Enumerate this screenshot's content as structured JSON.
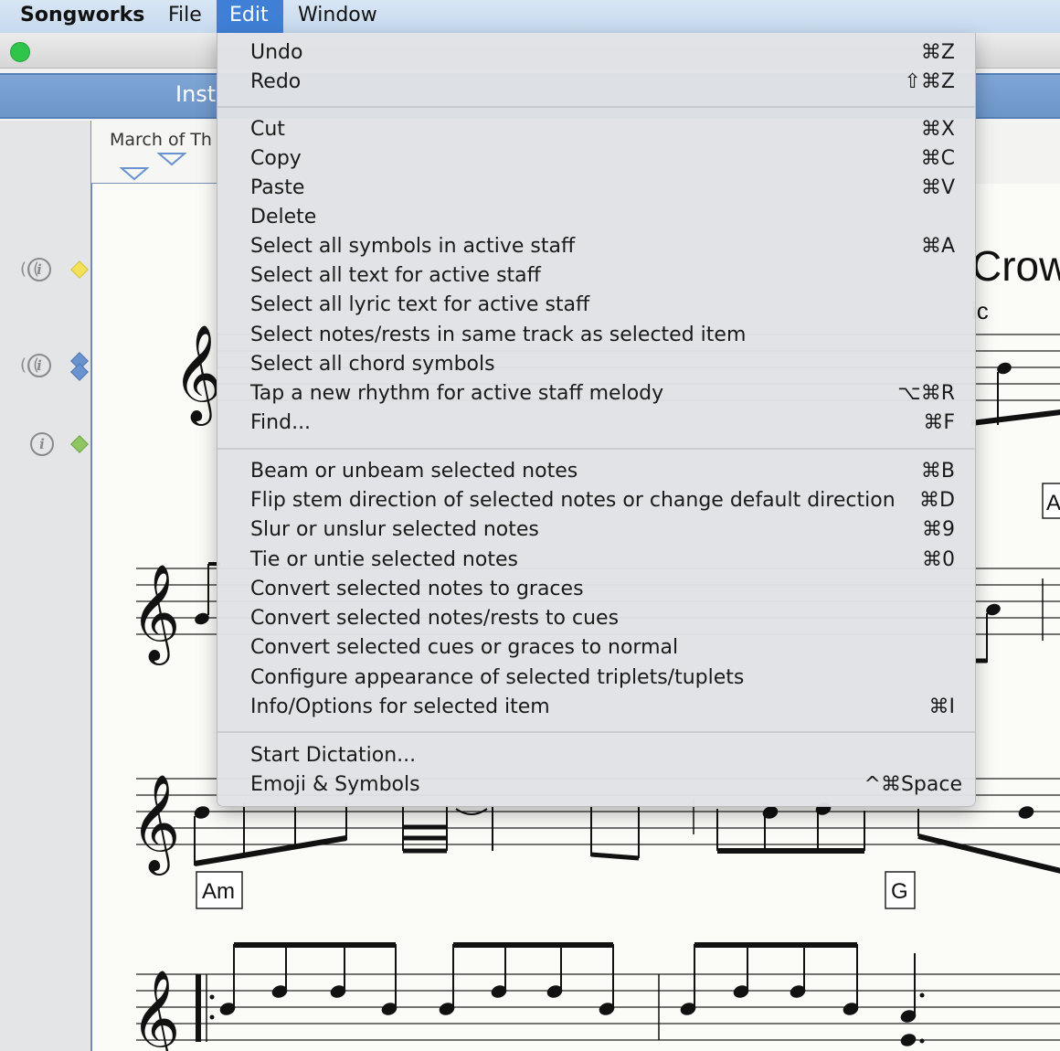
{
  "menubar": {
    "app_name": "Songworks",
    "items": [
      "File",
      "Edit",
      "Window"
    ],
    "active": "Edit"
  },
  "window": {
    "instrument_bar_label": "Inst",
    "tab_label": "March of Th"
  },
  "score": {
    "title_fragment": "Crow",
    "subtitle_fragment": "ic",
    "chords": [
      "Am",
      "G",
      "A"
    ]
  },
  "edit_menu": {
    "groups": [
      [
        {
          "label": "Undo",
          "shortcut": "⌘Z"
        },
        {
          "label": "Redo",
          "shortcut": "⇧⌘Z"
        }
      ],
      [
        {
          "label": "Cut",
          "shortcut": "⌘X"
        },
        {
          "label": "Copy",
          "shortcut": "⌘C"
        },
        {
          "label": "Paste",
          "shortcut": "⌘V"
        },
        {
          "label": "Delete",
          "shortcut": ""
        },
        {
          "label": "Select all symbols in active staff",
          "shortcut": "⌘A"
        },
        {
          "label": "Select all text for active staff",
          "shortcut": ""
        },
        {
          "label": "Select all lyric text for active staff",
          "shortcut": ""
        },
        {
          "label": "Select notes/rests in same track as selected item",
          "shortcut": ""
        },
        {
          "label": "Select all chord symbols",
          "shortcut": ""
        },
        {
          "label": "Tap a new rhythm for active staff melody",
          "shortcut": "⌥⌘R"
        },
        {
          "label": "Find...",
          "shortcut": "⌘F"
        }
      ],
      [
        {
          "label": "Beam or unbeam selected notes",
          "shortcut": "⌘B"
        },
        {
          "label": "Flip stem direction of selected notes or change default direction",
          "shortcut": "⌘D"
        },
        {
          "label": "Slur or unslur selected notes",
          "shortcut": "⌘9"
        },
        {
          "label": "Tie or untie selected notes",
          "shortcut": "⌘0"
        },
        {
          "label": "Convert selected notes to graces",
          "shortcut": ""
        },
        {
          "label": "Convert selected notes/rests to cues",
          "shortcut": ""
        },
        {
          "label": "Convert selected cues or graces to normal",
          "shortcut": ""
        },
        {
          "label": "Configure appearance of selected triplets/tuplets",
          "shortcut": ""
        },
        {
          "label": "Info/Options for selected item",
          "shortcut": "⌘I"
        }
      ],
      [
        {
          "label": "Start Dictation...",
          "shortcut": ""
        },
        {
          "label": "Emoji & Symbols",
          "shortcut": "^⌘Space"
        }
      ]
    ]
  },
  "colors": {
    "menubar_active": "#3f7fd6",
    "instrument_bar": "#6c95c8",
    "diamond_yellow": "#f2df5a",
    "diamond_blue": "#6a93cf",
    "diamond_green": "#8fc562"
  },
  "icons": [
    "green-window-button",
    "info-icon",
    "sound-waves-icon",
    "diamond-marker",
    "treble-clef-icon"
  ]
}
